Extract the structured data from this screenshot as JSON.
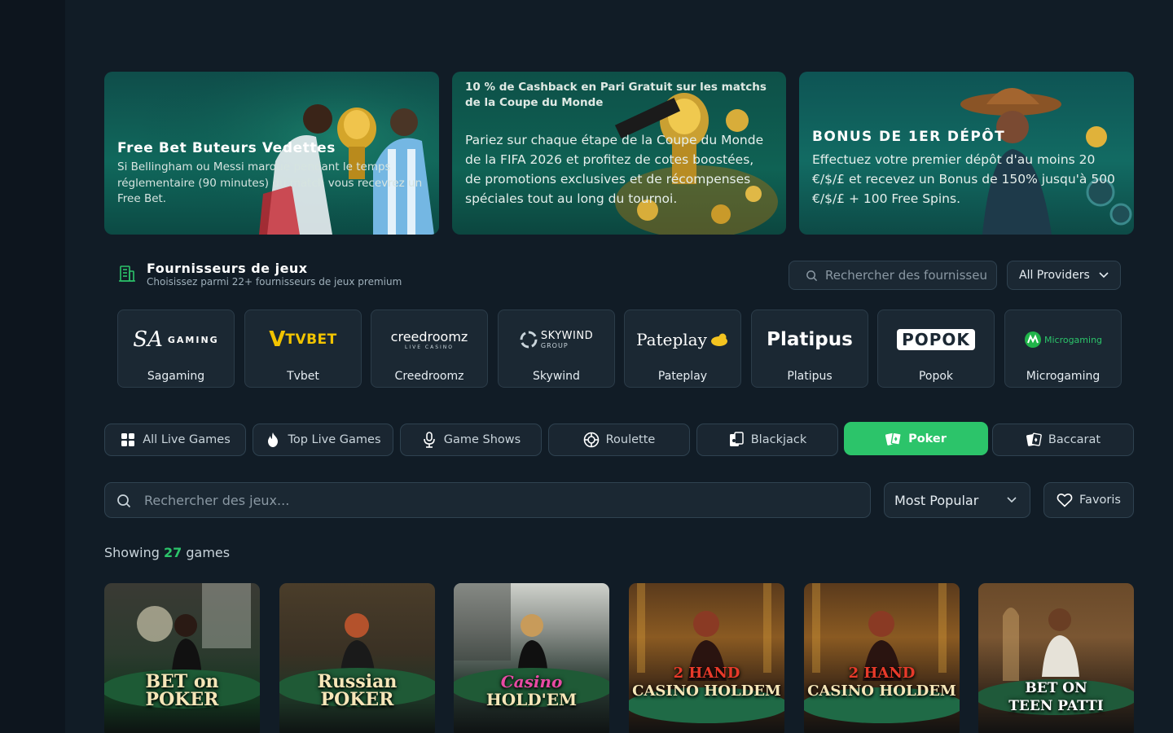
{
  "promos": [
    {
      "title": "Free Bet Buteurs Vedettes",
      "description": "Si Bellingham ou Messi marque pendant le temps réglementaire (90 minutes) du match vous recevrez un Free Bet."
    },
    {
      "title": "10 % de Cashback en Pari Gratuit sur les matchs de la Coupe du Monde",
      "description": "Pariez sur chaque étape de la Coupe du Monde de la FIFA 2026 et profitez de cotes boostées, de promotions exclusives et de récompenses spéciales tout au long du tournoi."
    },
    {
      "title": "BONUS DE 1ER DÉPÔT",
      "description": "Effectuez votre premier dépôt d'au moins 20 €/$/£ et recevez un Bonus de 150% jusqu'à 500 €/$/£ + 100 Free Spins."
    }
  ],
  "providers": {
    "title": "Fournisseurs de jeux",
    "subtitle": "Choisissez parmi 22+ fournisseurs de jeux premium",
    "search_placeholder": "Rechercher des fournisseurs...",
    "filter_label": "All Providers",
    "items": [
      {
        "name": "Sagaming",
        "logo_text": "GAMING",
        "logo_mark": "SA"
      },
      {
        "name": "Tvbet",
        "logo_text": "TVBET",
        "logo_mark": "V"
      },
      {
        "name": "Creedroomz",
        "logo_text": "creedroomz",
        "logo_sub": "LIVE CASINO"
      },
      {
        "name": "Skywind",
        "logo_text": "SKYWIND",
        "logo_sub": "GROUP"
      },
      {
        "name": "Pateplay",
        "logo_text": "Pateplay"
      },
      {
        "name": "Platipus",
        "logo_text": "Platipus"
      },
      {
        "name": "Popok",
        "logo_text": "POPOK"
      },
      {
        "name": "Microgaming",
        "logo_text": "Microgaming"
      }
    ]
  },
  "tabs": [
    {
      "label": "All Live Games",
      "icon": "grid-icon"
    },
    {
      "label": "Top Live Games",
      "icon": "flame-icon"
    },
    {
      "label": "Game Shows",
      "icon": "microphone-icon"
    },
    {
      "label": "Roulette",
      "icon": "roulette-icon"
    },
    {
      "label": "Blackjack",
      "icon": "cards-icon"
    },
    {
      "label": "Poker",
      "icon": "poker-cards-icon",
      "active": true
    },
    {
      "label": "Baccarat",
      "icon": "baccarat-cards-icon"
    }
  ],
  "games_search": {
    "placeholder": "Rechercher des jeux...",
    "sort_label": "Most Popular",
    "favorites_label": "Favoris"
  },
  "results": {
    "prefix": "Showing",
    "count": "27",
    "suffix": "games"
  },
  "games": [
    {
      "title_line1": "BET on",
      "title_line2": "POKER"
    },
    {
      "title_line1": "Russian",
      "title_line2": "POKER"
    },
    {
      "title_line1": "Casino",
      "title_line2": "HOLD'EM"
    },
    {
      "title_line1": "2 HAND",
      "title_line2": "CASINO HOLDEM"
    },
    {
      "title_line1": "2 HAND",
      "title_line2": "CASINO HOLDEM"
    },
    {
      "title_line1": "BET ON",
      "title_line2": "TEEN PATTI"
    }
  ],
  "colors": {
    "accent": "#2cc46a",
    "background": "#111c26",
    "card": "#1b2833",
    "border": "#2f4250"
  }
}
